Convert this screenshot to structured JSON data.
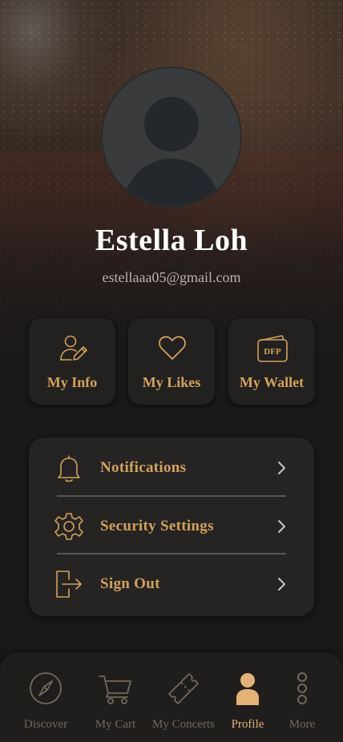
{
  "user": {
    "name": "Estella Loh",
    "email": "estellaaa05@gmail.com"
  },
  "quick_actions": [
    {
      "label": "My Info",
      "icon": "user-edit-icon"
    },
    {
      "label": "My Likes",
      "icon": "heart-icon"
    },
    {
      "label": "My Wallet",
      "icon": "wallet-icon",
      "icon_text": "DFP"
    }
  ],
  "menu": [
    {
      "label": "Notifications",
      "icon": "bell-icon"
    },
    {
      "label": "Security Settings",
      "icon": "gear-icon"
    },
    {
      "label": "Sign Out",
      "icon": "sign-out-icon"
    }
  ],
  "tabs": [
    {
      "label": "Discover",
      "icon": "compass-icon"
    },
    {
      "label": "My Cart",
      "icon": "cart-icon"
    },
    {
      "label": "My Concerts",
      "icon": "ticket-icon"
    },
    {
      "label": "Profile",
      "icon": "person-icon",
      "active": true
    },
    {
      "label": "More",
      "icon": "more-icon"
    }
  ],
  "colors": {
    "accent": "#d4a25a",
    "active_tab": "#e3b277",
    "inactive_tab": "#74685a",
    "card_bg": "#222120",
    "page_bg": "#1a1918"
  }
}
